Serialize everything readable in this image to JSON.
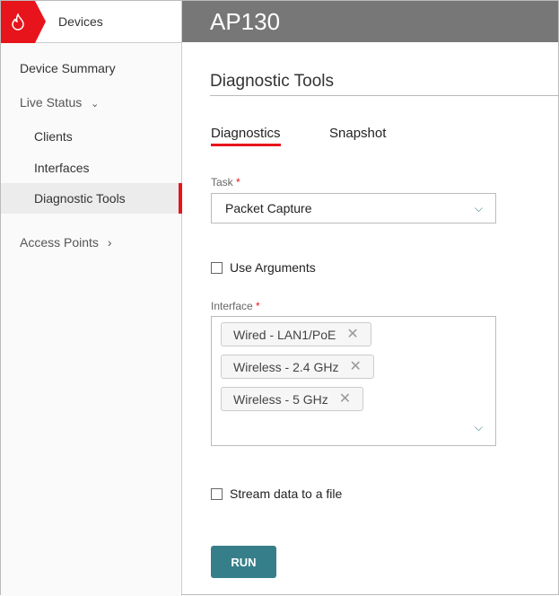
{
  "sidebar": {
    "title": "Devices",
    "items": [
      {
        "label": "Device Summary"
      },
      {
        "label": "Live Status"
      },
      {
        "label": "Clients"
      },
      {
        "label": "Interfaces"
      },
      {
        "label": "Diagnostic Tools"
      },
      {
        "label": "Access Points"
      }
    ]
  },
  "header": {
    "title": "AP130"
  },
  "main": {
    "section_title": "Diagnostic Tools",
    "tabs": [
      {
        "label": "Diagnostics"
      },
      {
        "label": "Snapshot"
      }
    ],
    "task": {
      "label": "Task",
      "required": "*",
      "value": "Packet Capture"
    },
    "use_arguments": {
      "label": "Use Arguments",
      "checked": false
    },
    "interface": {
      "label": "Interface",
      "required": "*",
      "chips": [
        "Wired - LAN1/PoE",
        "Wireless - 2.4 GHz",
        "Wireless - 5 GHz"
      ]
    },
    "stream": {
      "label": "Stream data to a file",
      "checked": false
    },
    "run_label": "RUN"
  },
  "colors": {
    "accent": "#e8141b",
    "button": "#367f8a",
    "header": "#777777"
  }
}
